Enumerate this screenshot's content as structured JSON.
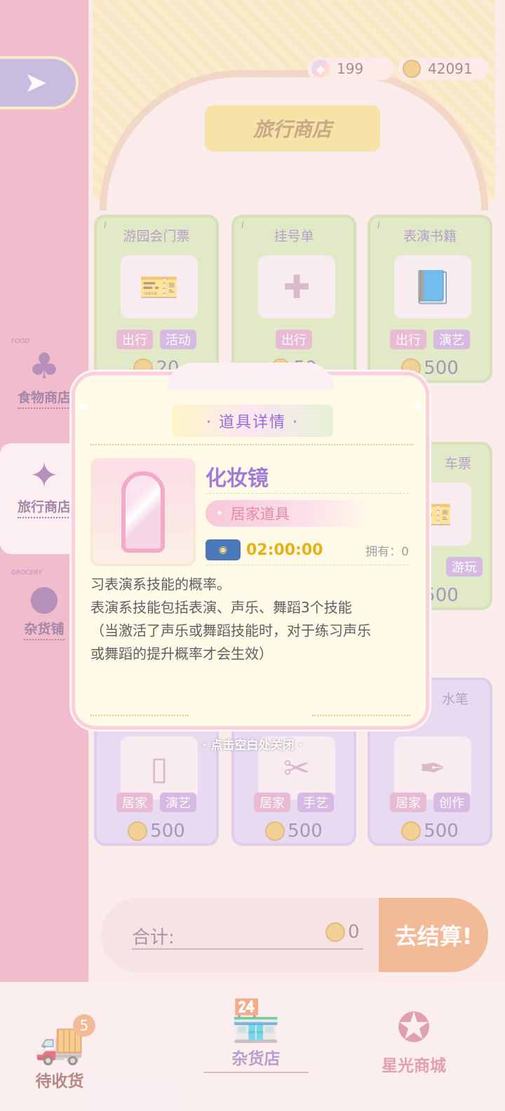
{
  "currency": {
    "gems": "199",
    "coins": "42091"
  },
  "header": {
    "title": "旅行商店"
  },
  "sidebar": {
    "categories": [
      {
        "tag": "FOOD",
        "label": "食物商店",
        "icon": "cake-icon"
      },
      {
        "tag": "",
        "label": "旅行商店",
        "icon": "wand-icon"
      },
      {
        "tag": "GROCERY",
        "label": "杂货铺",
        "icon": "panda-icon"
      }
    ]
  },
  "shop": {
    "items": [
      {
        "name": "游园会门票",
        "tags": [
          "出行",
          "活动"
        ],
        "price": "20"
      },
      {
        "name": "挂号单",
        "tags": [
          "出行"
        ],
        "price": "50"
      },
      {
        "name": "表演书籍",
        "tags": [
          "出行",
          "演艺"
        ],
        "price": "500"
      },
      {
        "name": "车票",
        "tags": [
          "游玩"
        ],
        "price": "500"
      },
      {
        "name": "",
        "tags": [
          "居家",
          "演艺"
        ],
        "price": "500"
      },
      {
        "name": "",
        "tags": [
          "居家",
          "手艺"
        ],
        "price": "500"
      },
      {
        "name": "水笔",
        "tags": [
          "居家",
          "创作"
        ],
        "price": "500"
      }
    ]
  },
  "checkout": {
    "total_label": "合计:",
    "total_value": "0",
    "button": "去结算!"
  },
  "nav": {
    "pending": {
      "label": "待收货",
      "badge": "5"
    },
    "grocery": {
      "label": "杂货店"
    },
    "star": {
      "label": "星光商城"
    }
  },
  "dialog": {
    "title": "· 道具详情 ·",
    "item_name": "化妆镜",
    "category": "居家道具",
    "timer": "02:00:00",
    "owned": "拥有：0",
    "description": [
      "习表演系技能的概率。",
      "表演系技能包括表演、声乐、舞蹈3个技能",
      "（当激活了声乐或舞蹈技能时，对于练习声乐",
      "或舞蹈的提升概率才会生效）"
    ]
  },
  "close_hint": "· 点击空白处关闭 ·"
}
